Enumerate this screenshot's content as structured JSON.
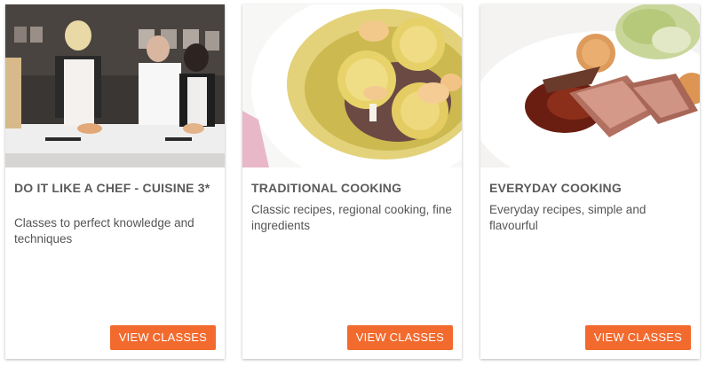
{
  "colors": {
    "accent": "#f26a2e",
    "title_text": "#5b5b5b",
    "body_text": "#555555",
    "card_background": "#ffffff"
  },
  "cards": [
    {
      "image_subject": "chefs-cooking-class-photo",
      "title": "DO IT LIKE A CHEF - CUISINE 3*",
      "description": "Classes to perfect knowledge and techniques",
      "button_label": "VIEW CLASSES"
    },
    {
      "image_subject": "ravioli-dish-photo",
      "title": "TRADITIONAL COOKING",
      "description": "Classic recipes, regional cooking, fine ingredients",
      "button_label": "VIEW CLASSES"
    },
    {
      "image_subject": "meat-plate-dish-photo",
      "title": "EVERYDAY COOKING",
      "description": "Everyday recipes, simple and flavourful",
      "button_label": "VIEW CLASSES"
    }
  ]
}
